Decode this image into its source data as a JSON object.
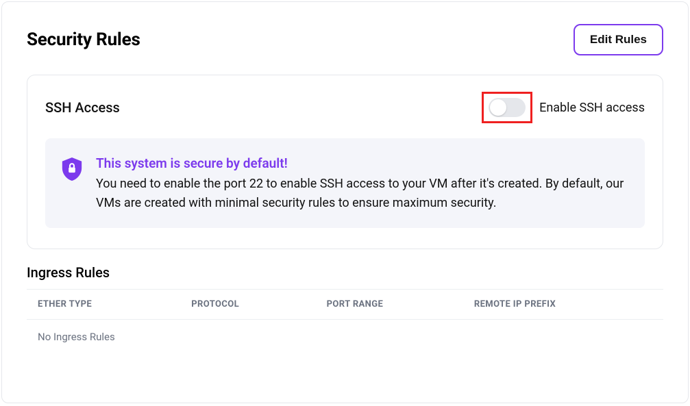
{
  "header": {
    "title": "Security Rules",
    "edit_button": "Edit Rules"
  },
  "ssh_card": {
    "title": "SSH Access",
    "toggle_label": "Enable SSH access",
    "toggle_on": false,
    "info": {
      "heading": "This system is secure by default!",
      "body": "You need to enable the port 22 to enable SSH access to your VM after it's created. By default, our VMs are created with minimal security rules to ensure maximum security."
    }
  },
  "ingress": {
    "title": "Ingress Rules",
    "columns": {
      "ether_type": "ETHER TYPE",
      "protocol": "PROTOCOL",
      "port_range": "PORT RANGE",
      "remote_ip_prefix": "REMOTE IP PREFIX"
    },
    "empty_message": "No Ingress Rules",
    "rows": []
  },
  "colors": {
    "accent": "#7c3aed",
    "highlight_border": "#ef2020",
    "border": "#e5e7eb",
    "muted_text": "#6b7280",
    "info_bg": "#f4f5fa"
  }
}
